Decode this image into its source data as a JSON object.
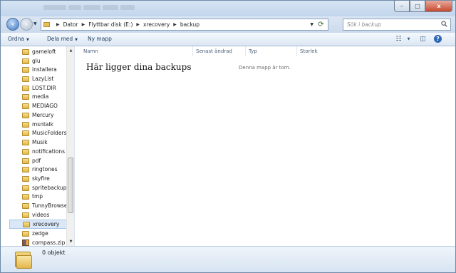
{
  "window": {
    "buttons": {
      "minimize": "–",
      "maximize": "□",
      "close": "x"
    }
  },
  "address": {
    "crumbs": [
      "Dator",
      "Flyttbar disk (E:)",
      "xrecovery",
      "backup"
    ]
  },
  "search": {
    "placeholder": "Sök i backup"
  },
  "toolbar": {
    "organize": "Ordna",
    "share": "Dela med",
    "new_folder": "Ny mapp"
  },
  "sidebar": {
    "items": [
      {
        "label": "gameloft"
      },
      {
        "label": "glu"
      },
      {
        "label": "installera"
      },
      {
        "label": "LazyList"
      },
      {
        "label": "LOST.DIR"
      },
      {
        "label": "media"
      },
      {
        "label": "MEDIAGO"
      },
      {
        "label": "Mercury"
      },
      {
        "label": "msntalk"
      },
      {
        "label": "MusicFolders"
      },
      {
        "label": "Musik"
      },
      {
        "label": "notifications"
      },
      {
        "label": "pdf"
      },
      {
        "label": "ringtones"
      },
      {
        "label": "skyfire"
      },
      {
        "label": "spritebackup"
      },
      {
        "label": "tmp"
      },
      {
        "label": "TunnyBrowser"
      },
      {
        "label": "videos"
      },
      {
        "label": "xrecovery",
        "selected": true
      },
      {
        "label": "zedge"
      },
      {
        "label": "compass.zip",
        "icon": "zip-archive-icon"
      }
    ]
  },
  "columns": [
    "Namn",
    "Senast ändrad",
    "Typ",
    "Storlek"
  ],
  "main": {
    "hint": "Här ligger dina backups",
    "empty_message": "Denna mapp är tom."
  },
  "status": {
    "count": "0 objekt"
  }
}
